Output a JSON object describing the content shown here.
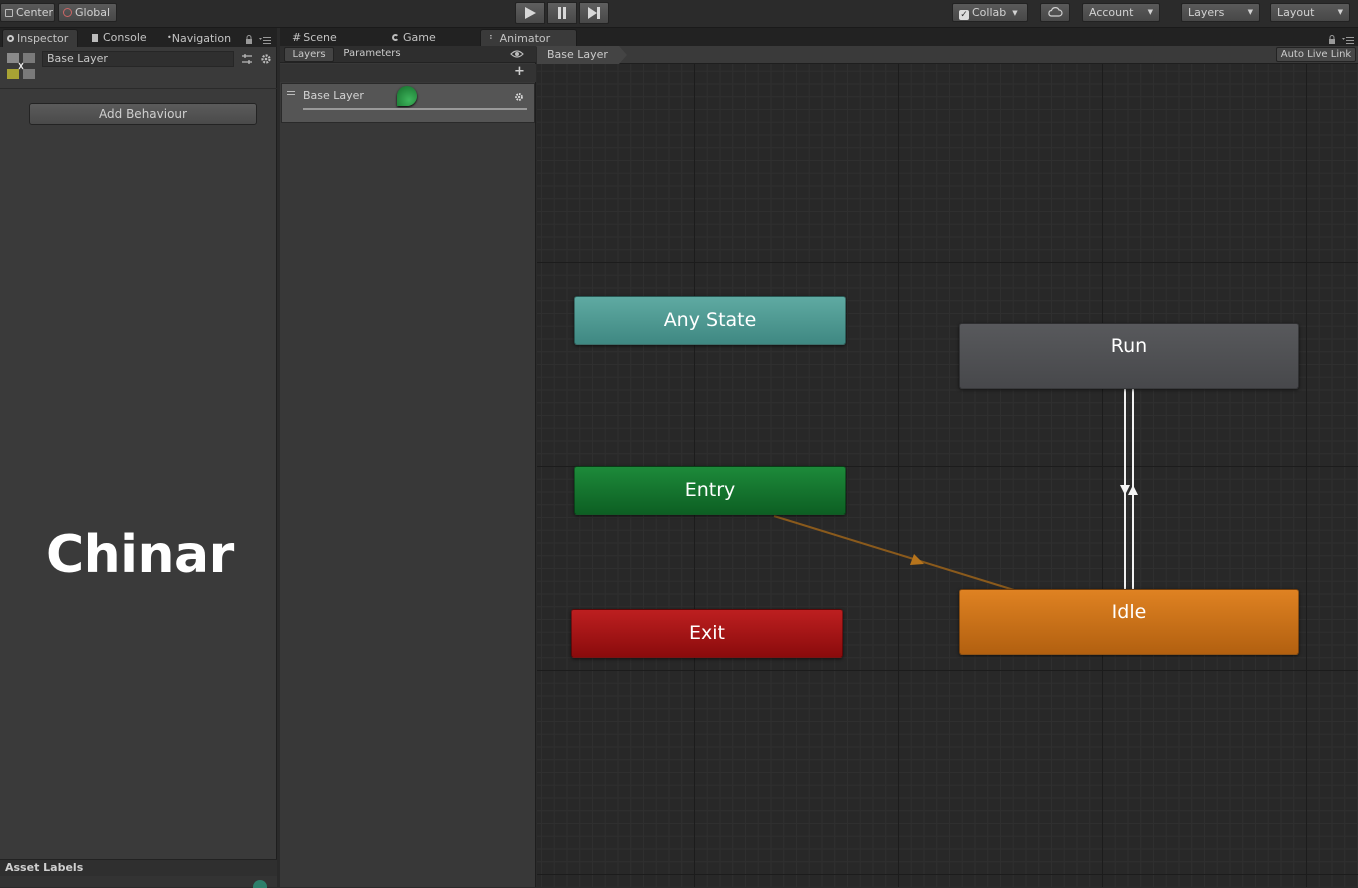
{
  "toolbar": {
    "center_label": "Center",
    "global_label": "Global",
    "collab_label": "Collab",
    "account_label": "Account",
    "layers_label": "Layers",
    "layout_label": "Layout"
  },
  "left_tabs": {
    "inspector": "Inspector",
    "console": "Console",
    "navigation": "Navigation"
  },
  "inspector": {
    "name_value": "Base Layer",
    "add_behaviour_label": "Add Behaviour",
    "watermark": "Chinar",
    "asset_labels": "Asset Labels"
  },
  "center_tabs": {
    "scene": "Scene",
    "game": "Game",
    "animator": "Animator"
  },
  "animator": {
    "layers_tab": "Layers",
    "parameters_tab": "Parameters",
    "layer_name": "Base Layer",
    "breadcrumb": "Base Layer",
    "auto_live_link": "Auto Live Link"
  },
  "states": {
    "any_state": "Any State",
    "entry": "Entry",
    "exit": "Exit",
    "run": "Run",
    "idle": "Idle"
  },
  "colors": {
    "any_state": "#4f9e97",
    "entry": "#13752e",
    "exit": "#a51516",
    "run": "#4f5053",
    "idle": "#d0761c",
    "transition_default": "#8a5a1c"
  },
  "icons": [
    "play-icon",
    "pause-icon",
    "step-icon",
    "cloud-icon",
    "checkbox-icon",
    "lock-icon",
    "menu-icon",
    "eye-icon",
    "plus-icon",
    "gear-icon",
    "inspector-icon",
    "console-icon",
    "scene-icon",
    "game-icon",
    "animator-icon",
    "layer-weight-icon"
  ]
}
